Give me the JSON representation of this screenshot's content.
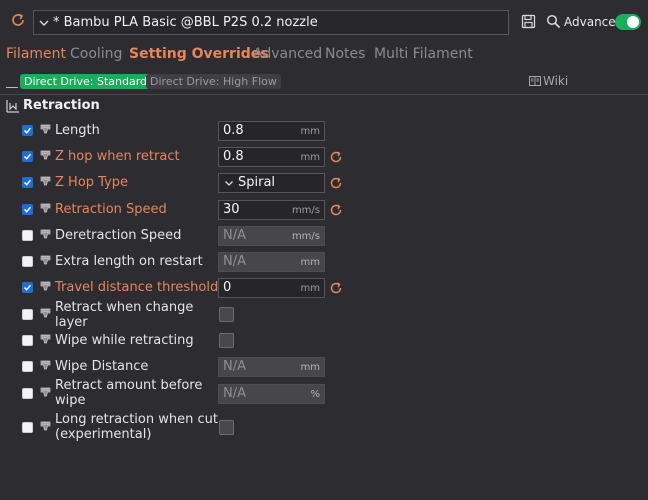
{
  "header": {
    "preset_name": "* Bambu PLA Basic @BBL P2S 0.2 nozzle",
    "advanced_label": "Advanced",
    "advanced_on": true
  },
  "tabs": [
    {
      "label": "Filament",
      "state": "modified"
    },
    {
      "label": "Cooling",
      "state": "normal"
    },
    {
      "label": "Setting Overrides",
      "state": "active"
    },
    {
      "label": "Advanced",
      "state": "normal"
    },
    {
      "label": "Notes",
      "state": "normal"
    },
    {
      "label": "Multi Filament",
      "state": "normal"
    }
  ],
  "subtabs": {
    "active": "Direct Drive: Standard",
    "inactive": "Direct Drive: High Flow",
    "wiki": "Wiki"
  },
  "section": {
    "title": "Retraction"
  },
  "rows": [
    {
      "label": "Length",
      "checked": true,
      "modified": false,
      "value": "0.8",
      "unit": "mm"
    },
    {
      "label": "Z hop when retract",
      "checked": true,
      "modified": true,
      "value": "0.8",
      "unit": "mm"
    },
    {
      "label": "Z Hop Type",
      "checked": true,
      "modified": true,
      "value": "Spiral",
      "unit": ""
    },
    {
      "label": "Retraction Speed",
      "checked": true,
      "modified": true,
      "value": "30",
      "unit": "mm/s"
    },
    {
      "label": "Deretraction Speed",
      "checked": false,
      "modified": false,
      "value": "N/A",
      "unit": "mm/s"
    },
    {
      "label": "Extra length on restart",
      "checked": false,
      "modified": false,
      "value": "N/A",
      "unit": "mm"
    },
    {
      "label": "Travel distance threshold",
      "checked": true,
      "modified": true,
      "value": "0",
      "unit": "mm"
    },
    {
      "label_line1": "Retract when change",
      "label_line2": "layer",
      "checked": false,
      "modified": false
    },
    {
      "label": "Wipe while retracting",
      "checked": false,
      "modified": false
    },
    {
      "label": "Wipe Distance",
      "checked": false,
      "modified": false,
      "value": "N/A",
      "unit": "mm"
    },
    {
      "label_line1": "Retract amount before",
      "label_line2": "wipe",
      "checked": false,
      "modified": false,
      "value": "N/A",
      "unit": "%"
    },
    {
      "label_line1": "Long retraction when cut",
      "label_line2": "(experimental)",
      "checked": false,
      "modified": false
    }
  ],
  "colors": {
    "accent_green": "#1aae5c",
    "modified_orange": "#e5865c",
    "checkbox_blue": "#1d6fd6",
    "background": "#2d2d31"
  },
  "icons": [
    "refresh-icon",
    "chevron-down-icon",
    "save-icon",
    "search-icon",
    "wiki-icon",
    "collapse-icon",
    "nozzle-icon",
    "reset-icon",
    "checkmark-icon"
  ]
}
